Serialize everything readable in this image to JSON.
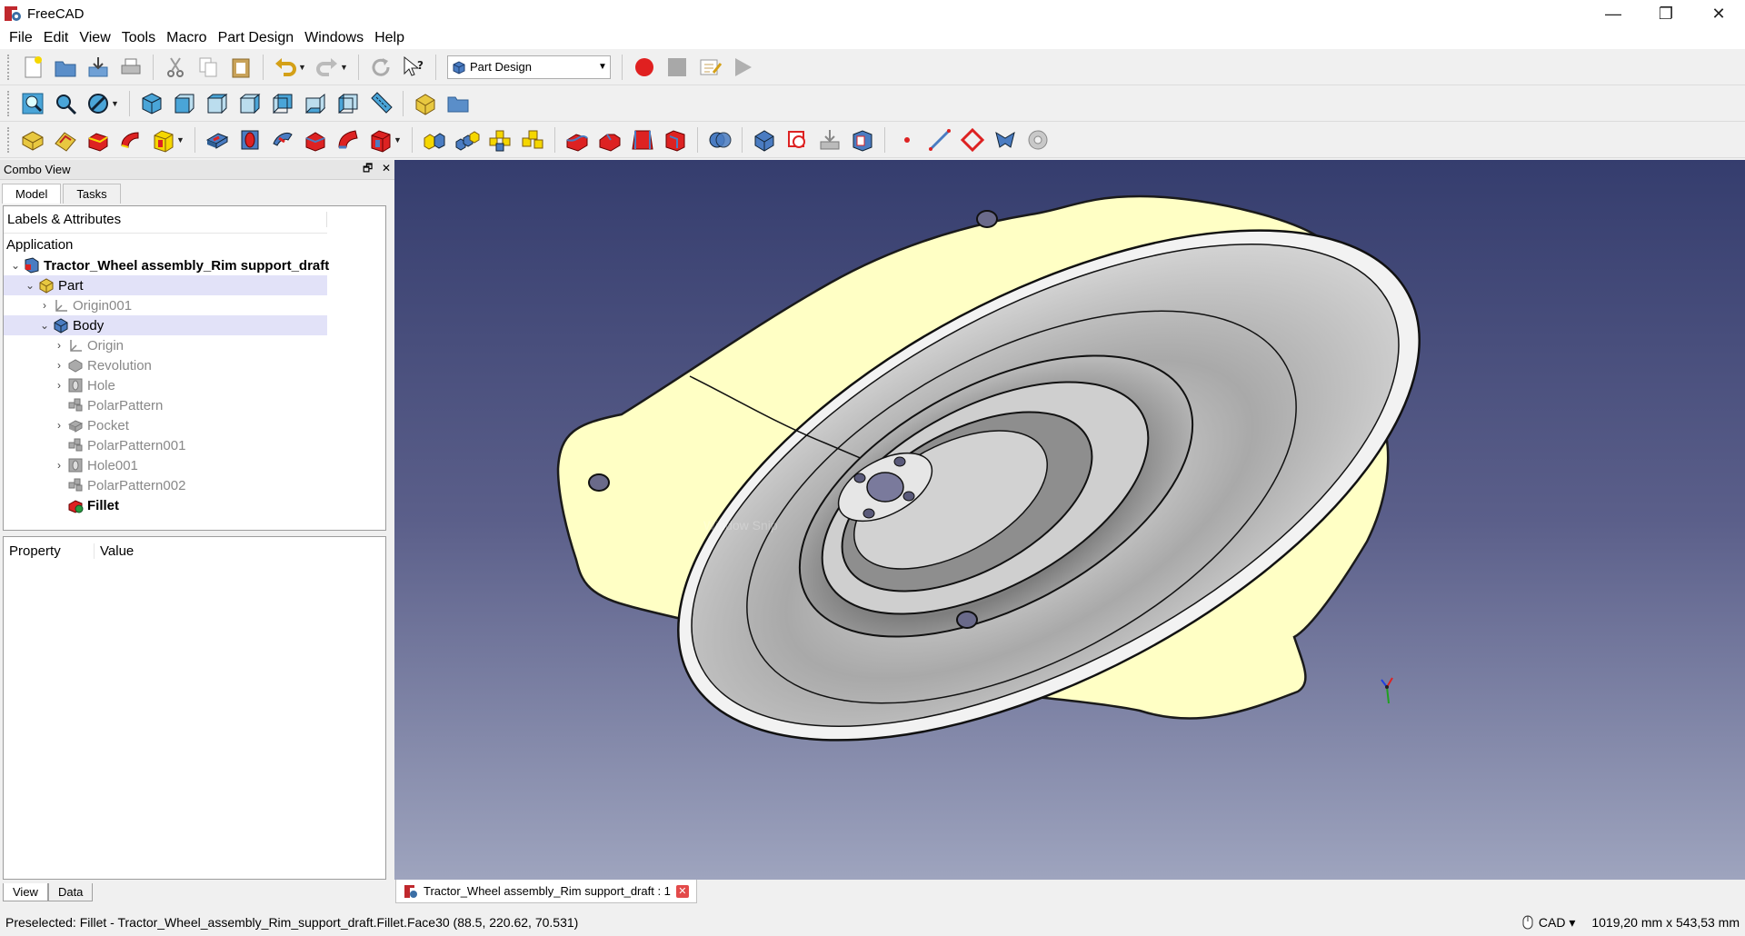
{
  "window": {
    "title": "FreeCAD",
    "minimize": "—",
    "maximize": "❐",
    "close": "✕"
  },
  "menu": [
    "File",
    "Edit",
    "View",
    "Tools",
    "Macro",
    "Part Design",
    "Windows",
    "Help"
  ],
  "toolbar": {
    "workbench": "Part Design"
  },
  "combo_view": {
    "title": "Combo View",
    "tabs": [
      "Model",
      "Tasks"
    ],
    "tree_header": "Labels & Attributes",
    "section": "Application",
    "tree": [
      {
        "label": "Tractor_Wheel assembly_Rim support_draft",
        "caret": "⌄",
        "icon": "document-icon",
        "style": "bold"
      },
      {
        "label": "Part",
        "caret": "⌄",
        "icon": "part-icon",
        "style": "normal"
      },
      {
        "label": "Origin001",
        "caret": "›",
        "icon": "origin-icon",
        "style": "gray"
      },
      {
        "label": "Body",
        "caret": "⌄",
        "icon": "body-icon",
        "style": "normal"
      },
      {
        "label": "Origin",
        "caret": "›",
        "icon": "origin-icon",
        "style": "gray"
      },
      {
        "label": "Revolution",
        "caret": "›",
        "icon": "revolution-icon",
        "style": "gray"
      },
      {
        "label": "Hole",
        "caret": "›",
        "icon": "hole-icon",
        "style": "gray"
      },
      {
        "label": "PolarPattern",
        "caret": "",
        "icon": "polar-pattern-icon",
        "style": "gray"
      },
      {
        "label": "Pocket",
        "caret": "›",
        "icon": "pocket-icon",
        "style": "gray"
      },
      {
        "label": "PolarPattern001",
        "caret": "",
        "icon": "polar-pattern-icon",
        "style": "gray"
      },
      {
        "label": "Hole001",
        "caret": "›",
        "icon": "hole-icon",
        "style": "gray"
      },
      {
        "label": "PolarPattern002",
        "caret": "",
        "icon": "polar-pattern-icon",
        "style": "gray"
      },
      {
        "label": "Fillet",
        "caret": "",
        "icon": "fillet-icon",
        "style": "bold"
      }
    ],
    "property_header": {
      "property": "Property",
      "value": "Value"
    },
    "property_tabs": [
      "View",
      "Data"
    ]
  },
  "view3d": {
    "ghost_text": "Window Snip"
  },
  "document_tab": {
    "label": "Tractor_Wheel assembly_Rim support_draft : 1",
    "close": "✕"
  },
  "statusbar": {
    "message": "Preselected: Fillet - Tractor_Wheel_assembly_Rim_support_draft.Fillet.Face30 (88.5, 220.62, 70.531)",
    "nav_style": "CAD ▾",
    "dimensions": "1019,20 mm x 543,53 mm"
  },
  "colors": {
    "face_yellow": "#ffffc5",
    "body_gray": "#9a9a9a",
    "view_top": "#353d6e",
    "view_bottom": "#9ea4be"
  }
}
